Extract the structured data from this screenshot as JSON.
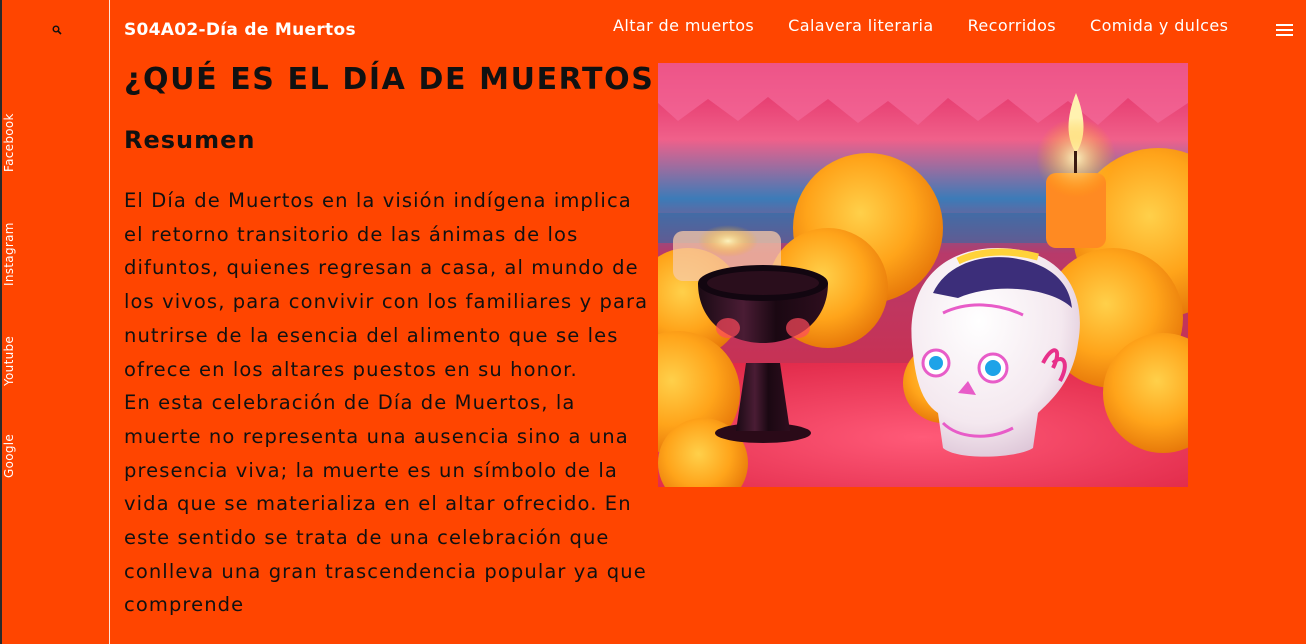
{
  "sidebar": {
    "search_icon": "search-icon",
    "social_links": [
      {
        "label": "Facebook"
      },
      {
        "label": "Instagram"
      },
      {
        "label": "Youtube"
      },
      {
        "label": "Google"
      }
    ]
  },
  "header": {
    "site_title": "S04A02-Día de Muertos",
    "nav_items": [
      {
        "label": "Altar de muertos"
      },
      {
        "label": "Calavera literaria"
      },
      {
        "label": "Recorridos"
      },
      {
        "label": "Comida y dulces"
      }
    ],
    "menu_icon": "hamburger-menu-icon"
  },
  "main": {
    "heading": "¿QUÉ ES EL DÍA DE MUERTOS ?",
    "subheading": "Resumen",
    "paragraphs": [
      "El Día de Muertos en la visión indígena implica el retorno transitorio de las ánimas de los difuntos, quienes regresan a casa, al mundo de los vivos, para convivir con los familiares y para nutrirse de la esencia del alimento que se les ofrece en los altares puestos en su honor.",
      "En esta celebración de Día de Muertos, la muerte no representa una ausencia sino a una presencia viva; la muerte es un símbolo de la vida que se materializa en el altar ofrecido. En este sentido se trata de una celebración que conlleva una gran trascendencia popular ya que comprende"
    ]
  },
  "colors": {
    "background": "#FF4500",
    "text_dark": "#111111",
    "text_light": "#FFFFFF"
  }
}
